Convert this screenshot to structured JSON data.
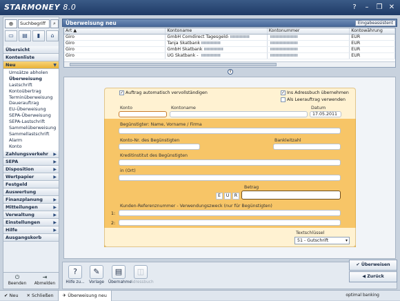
{
  "app": {
    "logo_text": "STARMONEY",
    "version": "8.0"
  },
  "window_controls": {
    "help": "?",
    "minimize": "–",
    "maximize": "❐",
    "close": "✕"
  },
  "sidebar": {
    "search_placeholder": "Suchbegriff",
    "search_value": "Suchbegriff",
    "nav": [
      {
        "label": "Übersicht"
      },
      {
        "label": "Kontenliste"
      },
      {
        "label": "Neu",
        "active": true
      },
      {
        "label": "Zahlungsverkehr"
      },
      {
        "label": "SEPA"
      },
      {
        "label": "Disposition"
      },
      {
        "label": "Wertpapier"
      },
      {
        "label": "Festgeld"
      },
      {
        "label": "Auswertung"
      },
      {
        "label": "Finanzplanung"
      },
      {
        "label": "Mitteilungen"
      },
      {
        "label": "Verwaltung"
      },
      {
        "label": "Einstellungen"
      },
      {
        "label": "Hilfe"
      },
      {
        "label": "Ausgangskorb"
      }
    ],
    "sub_items": [
      "Umsätze abholen",
      "Überweisung",
      "Lastschrift",
      "Kontoübertrag",
      "Terminüberweisung",
      "Dauerauftrag",
      "EU-Überweisung",
      "SEPA-Überweisung",
      "SEPA-Lastschrift",
      "Sammelüberweisung",
      "Sammellastschrift",
      "Alarm",
      "Konto"
    ],
    "footer": {
      "beenden": "Beenden",
      "abmelden": "Abmelden"
    }
  },
  "main": {
    "title": "Überweisung neu",
    "assist_button": "Eingabeassistent",
    "table": {
      "columns": [
        "Art ▲",
        "Kontoname",
        "Kontonummer",
        "Kontowährung"
      ],
      "rows": [
        [
          "Giro",
          "GmbH Comdirect Tagesgeld-",
          "",
          "EUR"
        ],
        [
          "Giro",
          "Tanja Skatbank",
          "",
          "EUR"
        ],
        [
          "Giro",
          "GmbH Skatbank",
          "",
          "EUR"
        ],
        [
          "Giro",
          "UG Skatbank - ",
          "",
          "EUR"
        ]
      ]
    },
    "form": {
      "auto_complete": "Auftrag automatisch vervollständigen",
      "adressbuch": "Ins Adressbuch übernehmen",
      "als_leer": "Als Leerauftrag verwenden",
      "konto_label": "Konto",
      "kontoname_label": "Kontoname",
      "datum_label": "Datum",
      "datum_value": "17.05.2011",
      "beguenstigter_label": "Begünstigter: Name, Vorname / Firma",
      "kontonr_label": "Konto-Nr. des Begünstigten",
      "blz_label": "Bankleitzahl",
      "kreditinstitut_label": "Kreditinstitut des Begünstigten",
      "ort_label": "in (Ort)",
      "betrag_label": "Betrag",
      "eur": [
        "E",
        "U",
        "R"
      ],
      "zweck_label": "Kunden-Referenznummer - Verwendungszweck (nur für Begünstigten)",
      "line1": "1:",
      "line2": "2:",
      "textschluessel_label": "Textschlüssel",
      "textschluessel_value": "51 - Gutschrift"
    },
    "tools": [
      {
        "label": "Hilfe zu...",
        "icon": "?"
      },
      {
        "label": "Vorlage",
        "icon": "✎"
      },
      {
        "label": "Übernahme",
        "icon": "▤"
      },
      {
        "label": "Adressbuch",
        "icon": "◫"
      }
    ],
    "ueberweisen_button": "Überweisen",
    "zurueck_button": "Zurück"
  },
  "statusbar": {
    "neu": "Neu",
    "schliessen": "Schließen",
    "tab": "Überweisung neu",
    "right": "optimal banking"
  }
}
